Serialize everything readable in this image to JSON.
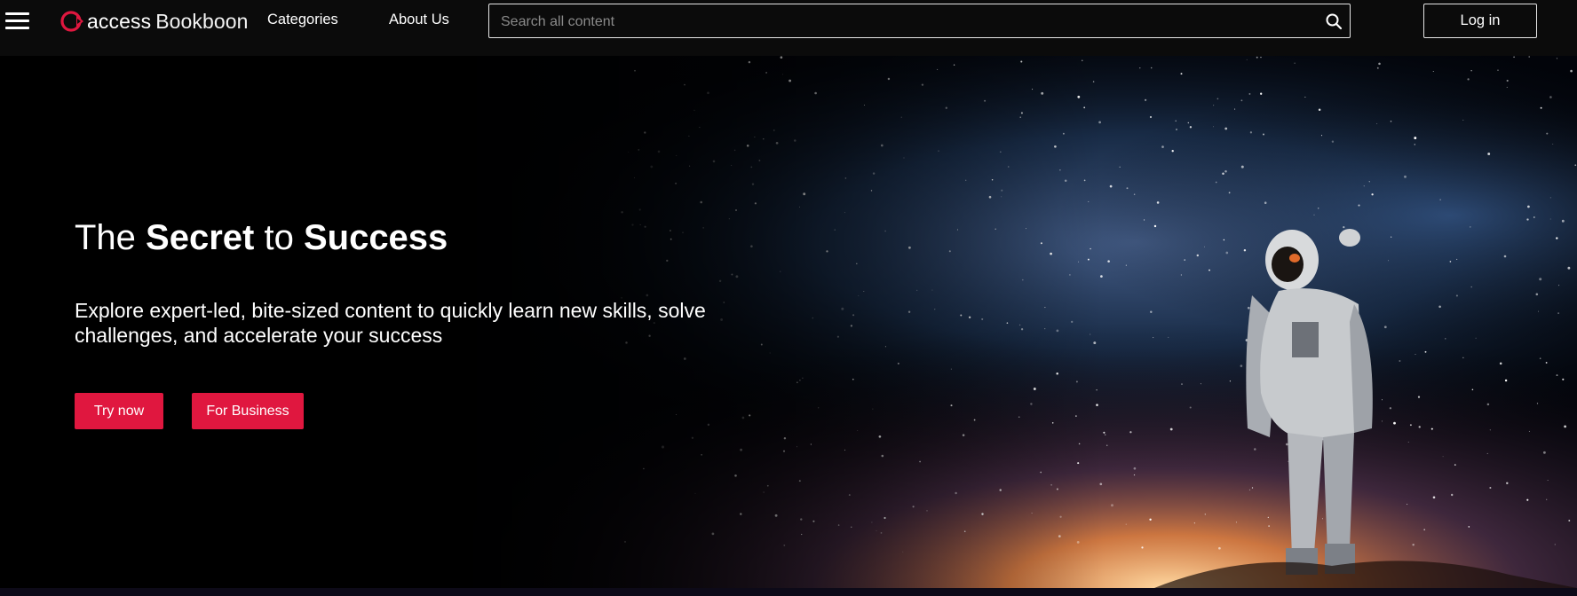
{
  "header": {
    "logo": {
      "part1": "access",
      "part2": "Bookboon"
    },
    "nav": [
      {
        "label": "Categories"
      },
      {
        "label": "About Us"
      }
    ],
    "search": {
      "placeholder": "Search all content",
      "value": ""
    },
    "login_label": "Log in"
  },
  "hero": {
    "title": {
      "w1": "The ",
      "w2": "Secret",
      "w3": " to ",
      "w4": "Success"
    },
    "description": "Explore expert-led, bite-sized content to quickly learn new skills, solve challenges, and accelerate your success",
    "buttons": {
      "try": "Try now",
      "business": "For Business"
    }
  },
  "colors": {
    "accent": "#e0173f",
    "header_bg": "#0b0b0b",
    "hero_bg": "#000000"
  },
  "icons": {
    "menu": "hamburger-menu-icon",
    "search": "search-icon",
    "logo": "bookboon-logo-icon"
  }
}
